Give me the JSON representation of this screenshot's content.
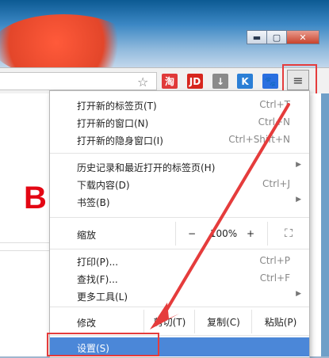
{
  "window": {
    "minimize": "▬",
    "maximize": "▢",
    "close": "✕"
  },
  "toolbar": {
    "star_icon": "☆",
    "extensions": [
      {
        "name": "taobao-icon",
        "label": "淘",
        "color": "#e03a3a"
      },
      {
        "name": "jd-icon",
        "label": "JD",
        "color": "#d7261e"
      },
      {
        "name": "download-icon",
        "label": "↓",
        "color": "#8a8a8a"
      },
      {
        "name": "k-icon",
        "label": "K",
        "color": "#2b7fd6"
      },
      {
        "name": "paw-icon",
        "label": "🐾",
        "color": "#2a6fe0"
      }
    ],
    "menu_icon": "≡"
  },
  "page": {
    "logo_letter": "B"
  },
  "menu": {
    "group1": [
      {
        "label": "打开新的标签页(T)",
        "shortcut": "Ctrl+T"
      },
      {
        "label": "打开新的窗口(N)",
        "shortcut": "Ctrl+N"
      },
      {
        "label": "打开新的隐身窗口(I)",
        "shortcut": "Ctrl+Shift+N"
      }
    ],
    "group2": [
      {
        "label": "历史记录和最近打开的标签页(H)",
        "shortcut": "",
        "submenu": true
      },
      {
        "label": "下载内容(D)",
        "shortcut": "Ctrl+J",
        "submenu": false
      },
      {
        "label": "书签(B)",
        "shortcut": "",
        "submenu": true
      }
    ],
    "zoom": {
      "label": "缩放",
      "minus": "−",
      "value": "100%",
      "plus": "+",
      "fullscreen": "⛶"
    },
    "group3": [
      {
        "label": "打印(P)...",
        "shortcut": "Ctrl+P"
      },
      {
        "label": "查找(F)...",
        "shortcut": "Ctrl+F"
      },
      {
        "label": "更多工具(L)",
        "shortcut": "",
        "submenu": true
      }
    ],
    "edit": {
      "label": "修改",
      "cut": "剪切(T)",
      "copy": "复制(C)",
      "paste": "粘贴(P)"
    },
    "settings": "设置(S)",
    "submenu_arrow": "▶"
  },
  "colors": {
    "highlight": "#e53c3c",
    "selected": "#4b87d8"
  }
}
